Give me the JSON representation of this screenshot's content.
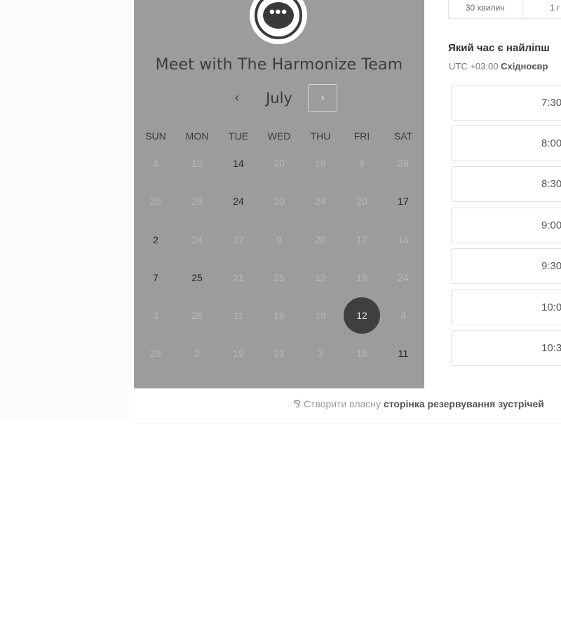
{
  "calendar": {
    "title": "Meet with The Harmonize Team",
    "logo_icon": "chat-bubble-icon",
    "logo_text": "•••",
    "month": "July",
    "prev_symbol": "‹",
    "next_symbol": "›",
    "weekdays": [
      "SUN",
      "MON",
      "TUE",
      "WED",
      "THU",
      "FRI",
      "SAT"
    ],
    "weeks": [
      [
        {
          "label": "4",
          "available": false
        },
        {
          "label": "10",
          "available": false
        },
        {
          "label": "14",
          "available": true
        },
        {
          "label": "20",
          "available": false
        },
        {
          "label": "16",
          "available": false
        },
        {
          "label": "9",
          "available": false
        },
        {
          "label": "28",
          "available": false
        }
      ],
      [
        {
          "label": "26",
          "available": false
        },
        {
          "label": "29",
          "available": false
        },
        {
          "label": "24",
          "available": true
        },
        {
          "label": "20",
          "available": false
        },
        {
          "label": "24",
          "available": false
        },
        {
          "label": "20",
          "available": false
        },
        {
          "label": "17",
          "available": true
        }
      ],
      [
        {
          "label": "2",
          "available": true
        },
        {
          "label": "24",
          "available": false
        },
        {
          "label": "27",
          "available": false
        },
        {
          "label": "9",
          "available": false
        },
        {
          "label": "20",
          "available": false
        },
        {
          "label": "17",
          "available": false
        },
        {
          "label": "14",
          "available": false
        }
      ],
      [
        {
          "label": "7",
          "available": true
        },
        {
          "label": "25",
          "available": true
        },
        {
          "label": "21",
          "available": false
        },
        {
          "label": "25",
          "available": false
        },
        {
          "label": "12",
          "available": false
        },
        {
          "label": "19",
          "available": false
        },
        {
          "label": "24",
          "available": false
        }
      ],
      [
        {
          "label": "3",
          "available": false
        },
        {
          "label": "26",
          "available": false
        },
        {
          "label": "11",
          "available": false
        },
        {
          "label": "19",
          "available": false
        },
        {
          "label": "19",
          "available": false
        },
        {
          "label": "12",
          "available": true,
          "selected": true
        },
        {
          "label": "4",
          "available": false
        }
      ],
      [
        {
          "label": "28",
          "available": false
        },
        {
          "label": "2",
          "available": false
        },
        {
          "label": "19",
          "available": false
        },
        {
          "label": "21",
          "available": false
        },
        {
          "label": "3",
          "available": false
        },
        {
          "label": "16",
          "available": false
        },
        {
          "label": "11",
          "available": true
        }
      ]
    ]
  },
  "booking": {
    "durations": [
      "30 хвилин",
      "1 г"
    ],
    "question": "Який час є найліпш",
    "timezone_prefix": "UTC +03:00 ",
    "timezone_name": "Східноєвр",
    "slots": [
      "7:30",
      "8:00",
      "8:30",
      "9:00",
      "9:30",
      "10:0",
      "10:3"
    ]
  },
  "footer": {
    "icon": "hubspot-sprocket-icon",
    "icon_glyph": "⅋",
    "prefix": "Створити власну ",
    "link": "сторінка резервування зустрічей"
  }
}
